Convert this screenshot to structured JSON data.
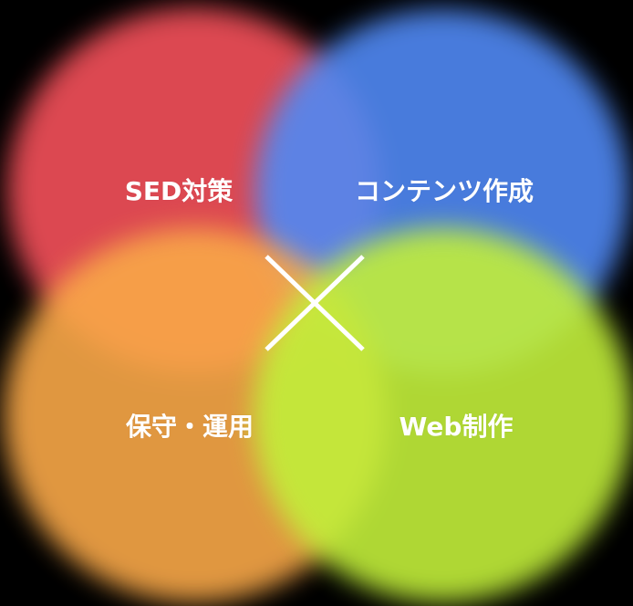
{
  "diagram": {
    "quadrants": [
      {
        "id": "seo",
        "label": "SED対策",
        "color": "#f4505a"
      },
      {
        "id": "content",
        "label": "コンテンツ作成",
        "color": "#5089f4"
      },
      {
        "id": "maint",
        "label": "保守・運用",
        "color": "#f9a848"
      },
      {
        "id": "web",
        "label": "Web制作",
        "color": "#c2ef3a"
      }
    ],
    "center_symbol": "cross",
    "center_color": "#ffffff"
  }
}
